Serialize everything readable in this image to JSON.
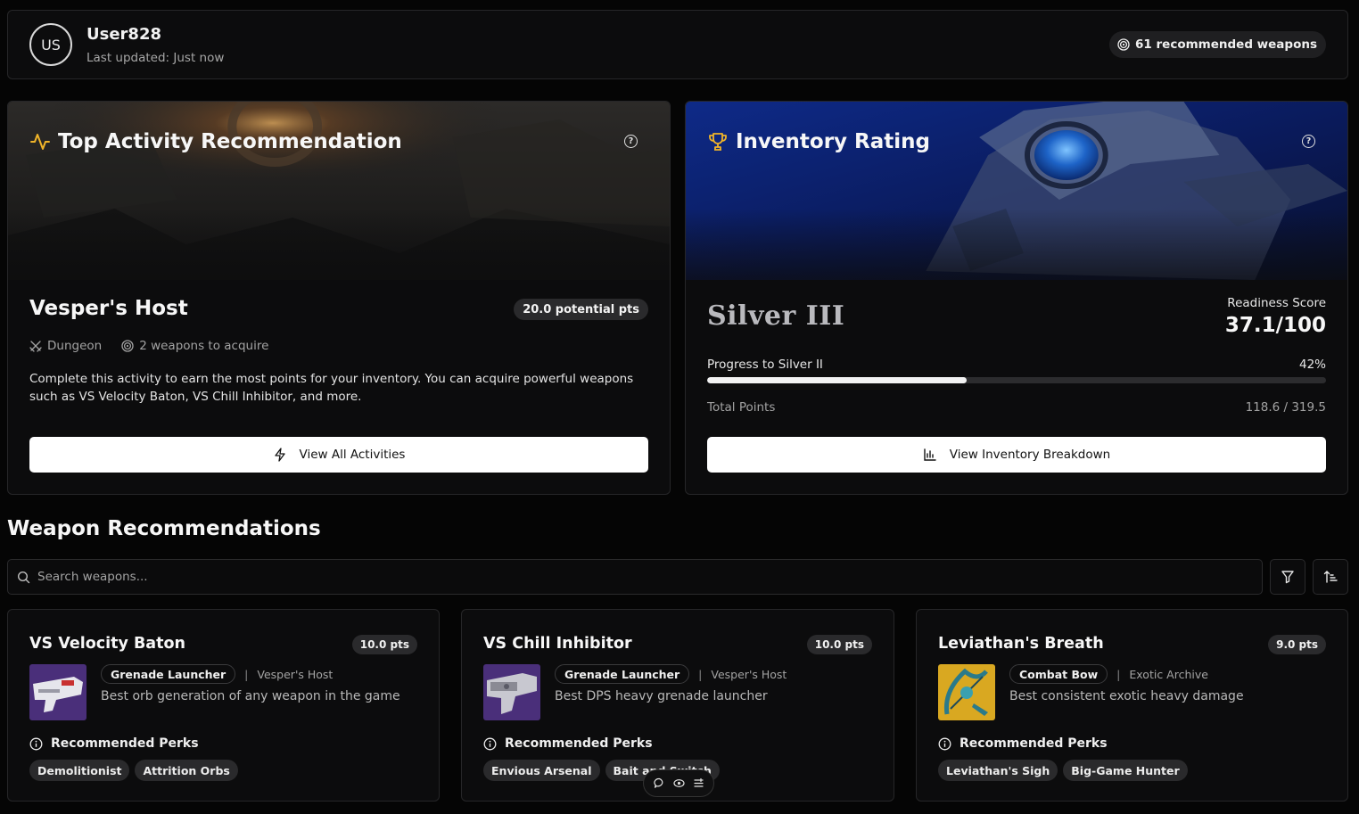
{
  "header": {
    "avatar_initials": "US",
    "username": "User828",
    "last_updated": "Last updated: Just now",
    "recommended_badge": "61 recommended weapons"
  },
  "activity": {
    "title": "Top Activity Recommendation",
    "name": "Vesper's Host",
    "points": "20.0 potential pts",
    "type": "Dungeon",
    "weapons_to_acquire": "2 weapons to acquire",
    "description": "Complete this activity to earn the most points for your inventory. You can acquire powerful weapons such as VS Velocity Baton, VS Chill Inhibitor, and more.",
    "button_label": "View All Activities",
    "accent_color": "#f0b429"
  },
  "inventory": {
    "title": "Inventory Rating",
    "tier": "Silver III",
    "readiness_label": "Readiness Score",
    "readiness_score": "37.1/100",
    "progress_label": "Progress to Silver II",
    "progress_percent": "42%",
    "progress_value": 0.42,
    "total_points_label": "Total Points",
    "total_points_value": "118.6 / 319.5",
    "button_label": "View Inventory Breakdown"
  },
  "weapons_section": {
    "title": "Weapon Recommendations",
    "search_placeholder": "Search weapons..."
  },
  "weapons": [
    {
      "name": "VS Velocity Baton",
      "points": "10.0 pts",
      "type": "Grenade Launcher",
      "source": "Vesper's Host",
      "description": "Best orb generation of any weapon in the game",
      "perks_heading": "Recommended Perks",
      "perks": [
        "Demolitionist",
        "Attrition Orbs"
      ]
    },
    {
      "name": "VS Chill Inhibitor",
      "points": "10.0 pts",
      "type": "Grenade Launcher",
      "source": "Vesper's Host",
      "description": "Best DPS heavy grenade launcher",
      "perks_heading": "Recommended Perks",
      "perks": [
        "Envious Arsenal",
        "Bait and Switch"
      ]
    },
    {
      "name": "Leviathan's Breath",
      "points": "9.0 pts",
      "type": "Combat Bow",
      "source": "Exotic Archive",
      "description": "Best consistent exotic heavy damage",
      "perks_heading": "Recommended Perks",
      "perks": [
        "Leviathan's Sigh",
        "Big-Game Hunter"
      ]
    }
  ],
  "icons": {
    "activity_title": "activity-pulse-icon",
    "inventory_title": "trophy-icon",
    "help": "help-circle-icon",
    "dungeon": "crossed-swords-icon",
    "target": "target-icon",
    "lightning": "lightning-icon",
    "chart": "bar-chart-icon",
    "search": "search-icon",
    "filter": "filter-icon",
    "sort": "sort-icon",
    "info": "info-icon"
  }
}
